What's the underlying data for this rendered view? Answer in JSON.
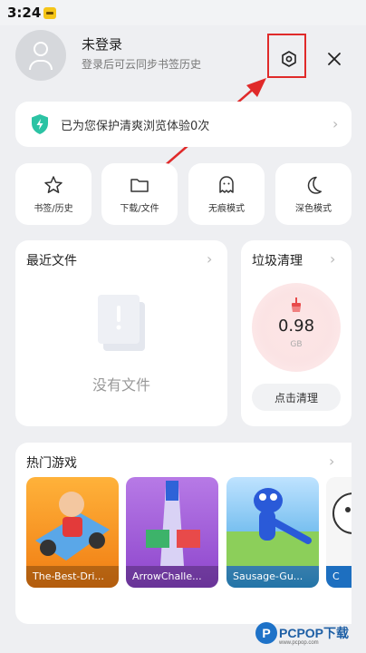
{
  "status_bar": {
    "time": "3:24"
  },
  "header": {
    "user_name": "未登录",
    "user_subtitle": "登录后可云同步书签历史"
  },
  "protection": {
    "text": "已为您保护清爽浏览体验0次"
  },
  "quick_actions": [
    {
      "label": "书签/历史",
      "icon": "star-icon"
    },
    {
      "label": "下载/文件",
      "icon": "folder-icon"
    },
    {
      "label": "无痕模式",
      "icon": "ghost-icon"
    },
    {
      "label": "深色模式",
      "icon": "moon-icon"
    }
  ],
  "recent_files": {
    "title": "最近文件",
    "empty_text": "没有文件"
  },
  "junk_clean": {
    "title": "垃圾清理",
    "value": "0.98",
    "unit": "GB",
    "button": "点击清理"
  },
  "games": {
    "title": "热门游戏",
    "items": [
      {
        "label": "The-Best-Dri...",
        "bg": "#f5a020"
      },
      {
        "label": "ArrowChalle...",
        "bg": "#a75fd8"
      },
      {
        "label": "Sausage-Gu...",
        "bg": "#2f9be0"
      },
      {
        "label": "C",
        "bg": "#1d6fc0"
      }
    ]
  },
  "watermark": {
    "text": "PCPOP下载",
    "sub": "www.pcpop.com"
  },
  "colors": {
    "accent": "#e02a2a",
    "shield": "#2cc3a4",
    "junk_broom": "#e84a4a"
  }
}
